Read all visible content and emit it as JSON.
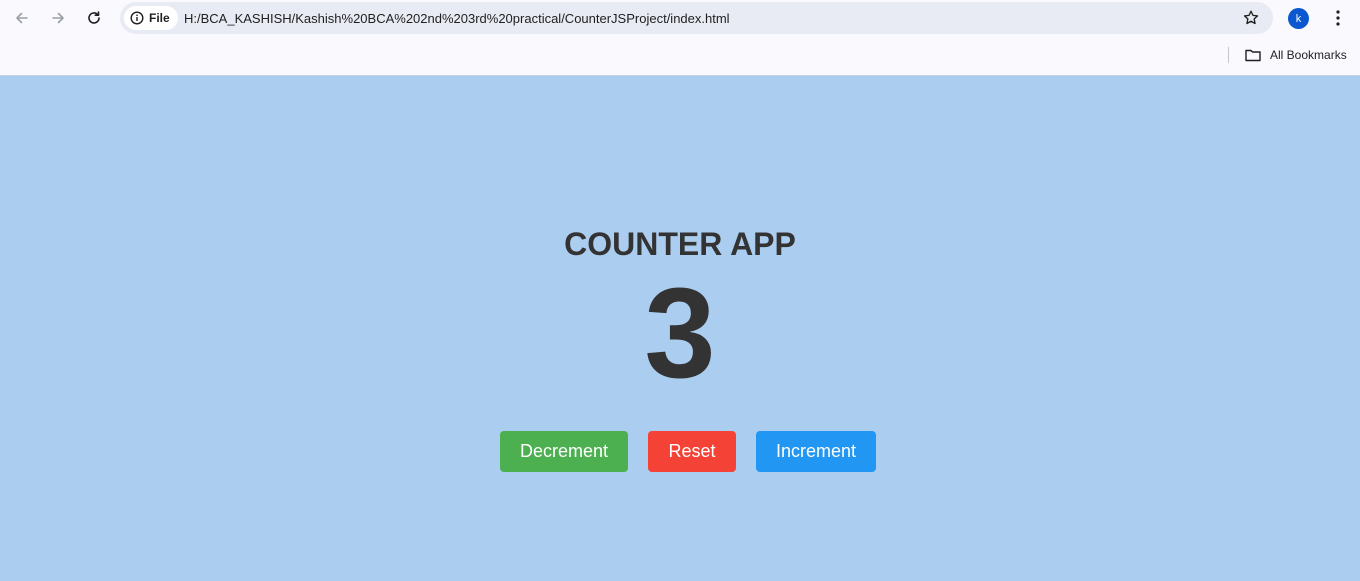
{
  "browser": {
    "site_chip_label": "File",
    "url": "H:/BCA_KASHISH/Kashish%20BCA%202nd%203rd%20practical/CounterJSProject/index.html",
    "profile_initial": "k",
    "bookmarks_label": "All Bookmarks",
    "icons": {
      "back": "arrow-left-icon",
      "forward": "arrow-right-icon",
      "reload": "reload-icon",
      "info": "info-icon",
      "star": "star-icon",
      "menu": "kebab-menu-icon",
      "folder": "folder-icon"
    }
  },
  "app": {
    "title": "COUNTER APP",
    "count": "3",
    "buttons": {
      "decrement": "Decrement",
      "reset": "Reset",
      "increment": "Increment"
    },
    "colors": {
      "background": "#abcdf0",
      "text": "#333333",
      "decrement": "#4caf50",
      "reset": "#f44336",
      "increment": "#2196f3"
    }
  }
}
